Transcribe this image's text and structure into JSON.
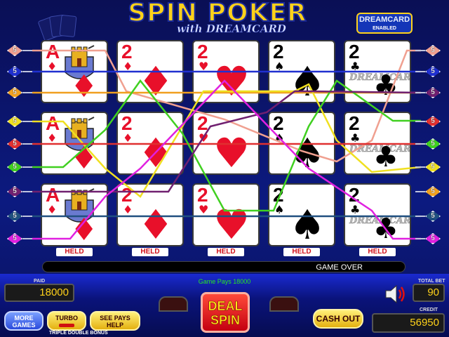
{
  "title": {
    "main": "SPIN POKER",
    "sub": "with DREAMCARD"
  },
  "badge": {
    "line1": "DREAMCARD",
    "line2": "ENABLED"
  },
  "grid": {
    "rows": [
      [
        {
          "rank": "A",
          "suit": "♦",
          "color": "red",
          "art": "castle"
        },
        {
          "rank": "2",
          "suit": "♦",
          "color": "red"
        },
        {
          "rank": "2",
          "suit": "♥",
          "color": "red"
        },
        {
          "rank": "2",
          "suit": "♠",
          "color": "black"
        },
        {
          "rank": "2",
          "suit": "♣",
          "color": "black",
          "art": "dreamcard"
        }
      ],
      [
        {
          "rank": "A",
          "suit": "♦",
          "color": "red",
          "art": "castle"
        },
        {
          "rank": "2",
          "suit": "♦",
          "color": "red"
        },
        {
          "rank": "2",
          "suit": "♥",
          "color": "red"
        },
        {
          "rank": "2",
          "suit": "♠",
          "color": "black"
        },
        {
          "rank": "2",
          "suit": "♣",
          "color": "black",
          "art": "dreamcard"
        }
      ],
      [
        {
          "rank": "A",
          "suit": "♦",
          "color": "red",
          "art": "castle"
        },
        {
          "rank": "2",
          "suit": "♦",
          "color": "red"
        },
        {
          "rank": "2",
          "suit": "♥",
          "color": "red"
        },
        {
          "rank": "2",
          "suit": "♠",
          "color": "black"
        },
        {
          "rank": "2",
          "suit": "♣",
          "color": "black",
          "art": "dreamcard"
        }
      ]
    ],
    "dreamcard_label": "DREAMCARD"
  },
  "held_label": "HELD",
  "paylines_left": [
    {
      "num": "5",
      "color": "#f0a090"
    },
    {
      "num": "5",
      "color": "#2030d0"
    },
    {
      "num": "5",
      "color": "#f0a020"
    },
    {
      "num": "5",
      "color": "#f0e020"
    },
    {
      "num": "5",
      "color": "#e03030"
    },
    {
      "num": "5",
      "color": "#40d020"
    },
    {
      "num": "5",
      "color": "#702070"
    },
    {
      "num": "5",
      "color": "#205080"
    },
    {
      "num": "5",
      "color": "#e020e0"
    }
  ],
  "paylines_right": [
    {
      "num": "5",
      "color": "#f0a090"
    },
    {
      "num": "5",
      "color": "#2030d0"
    },
    {
      "num": "5",
      "color": "#702070"
    },
    {
      "num": "5",
      "color": "#e03030"
    },
    {
      "num": "5",
      "color": "#40d020"
    },
    {
      "num": "5",
      "color": "#f0e020"
    },
    {
      "num": "5",
      "color": "#f0a020"
    },
    {
      "num": "5",
      "color": "#205080"
    },
    {
      "num": "5",
      "color": "#e020e0"
    }
  ],
  "status": {
    "message": "GAME OVER",
    "game_pays": "Game Pays 18000"
  },
  "meters": {
    "paid_label": "PAID",
    "paid": "18000",
    "total_bet_label": "TOTAL BET",
    "total_bet": "90",
    "credit_label": "CREDIT",
    "credit": "56950"
  },
  "buttons": {
    "more_games": "MORE GAMES",
    "turbo": "TURBO",
    "see_pays": "SEE PAYS HELP",
    "deal_spin": "DEAL SPIN",
    "cash_out": "CASH OUT"
  },
  "footer": "TRIPLE DOUBLE BONUS"
}
